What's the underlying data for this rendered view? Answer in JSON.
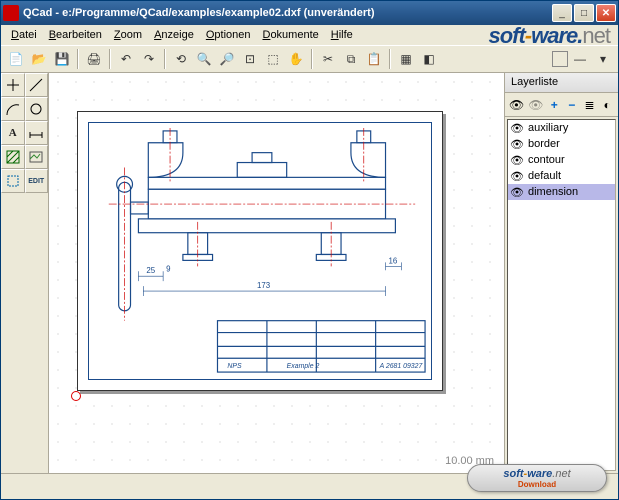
{
  "window": {
    "title": "QCad - e:/Programme/QCad/examples/example02.dxf (unverändert)"
  },
  "menu": {
    "items": [
      "Datei",
      "Bearbeiten",
      "Zoom",
      "Anzeige",
      "Optionen",
      "Dokumente",
      "Hilfe"
    ]
  },
  "watermark": {
    "p1": "soft",
    "hy": "-",
    "p2": "ware",
    "dot": ".",
    "net": "net"
  },
  "layerpanel": {
    "title": "Layerliste",
    "layers": [
      "auxiliary",
      "border",
      "contour",
      "default",
      "dimension"
    ],
    "selected": 4
  },
  "canvas": {
    "scale_label": "10.00 mm",
    "dimensions": {
      "d1": "25",
      "d2": "173",
      "d3": "16",
      "d4": "9"
    },
    "titleblock": {
      "f1": "NPS",
      "f2": "Example 2",
      "f3": "A 2681 09327"
    }
  },
  "download": {
    "line1a": "soft",
    "line1hy": "-",
    "line1b": "ware",
    "line1net": ".net",
    "line2": "Download"
  },
  "tooltext": {
    "edit": "EDIT",
    "A": "A"
  }
}
